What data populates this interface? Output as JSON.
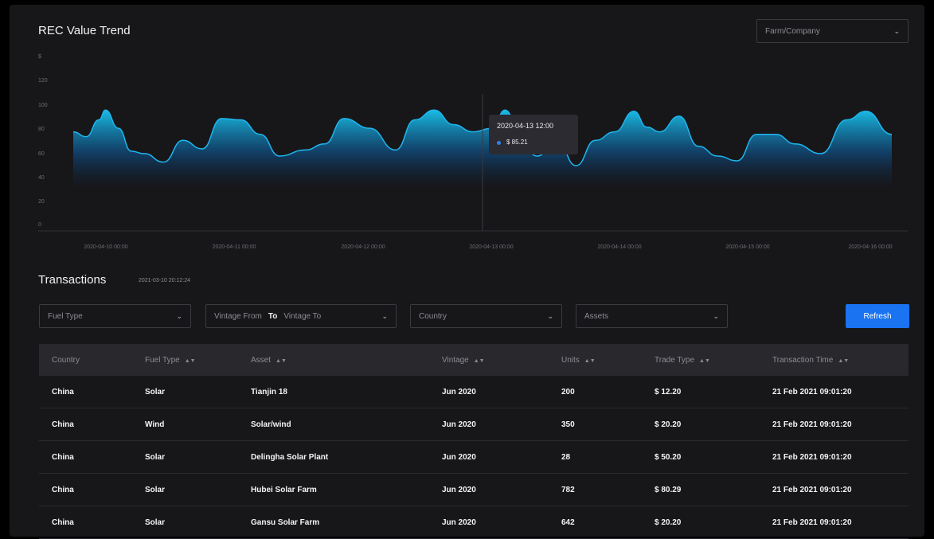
{
  "chart": {
    "title": "REC Value Trend",
    "filter_select": {
      "value": "Farm/Company"
    },
    "tooltip": {
      "time": "2020-04-13 12:00",
      "value": "$ 85.21"
    }
  },
  "chart_data": {
    "type": "area",
    "title": "REC Value Trend",
    "ylabel": "$",
    "ylim": [
      0,
      120
    ],
    "yticks": [
      "$",
      "120",
      "100",
      "80",
      "60",
      "40",
      "20",
      "0"
    ],
    "xticks": [
      "2020-04-10 00:00",
      "2020-04-11 00:00",
      "2020-04-12 00:00",
      "2020-04-13 00:00",
      "2020-04-14 00:00",
      "2020-04-15 00:00",
      "2020-04-16 00:00"
    ],
    "series": [
      {
        "x_days": [
          0,
          0.1,
          0.2,
          0.25,
          0.35,
          0.45,
          0.55,
          0.7,
          0.85,
          1.0,
          1.15,
          1.3,
          1.45,
          1.6,
          1.8,
          1.95,
          2.1,
          2.3,
          2.5,
          2.65,
          2.8,
          2.95,
          3.1,
          3.25,
          3.35,
          3.5,
          3.6,
          3.75,
          3.9,
          4.05,
          4.2,
          4.35,
          4.45,
          4.55,
          4.7,
          4.85,
          5.0,
          5.15,
          5.3,
          5.45,
          5.6,
          5.8,
          6.0,
          6.15,
          6.35
        ],
        "values": [
          82,
          78,
          92,
          100,
          85,
          66,
          64,
          57,
          75,
          68,
          93,
          92,
          80,
          62,
          67,
          72,
          93,
          85,
          67,
          92,
          100,
          88,
          82,
          85,
          100,
          68,
          62,
          76,
          54,
          75,
          82,
          99,
          86,
          82,
          95,
          70,
          62,
          58,
          80,
          80,
          72,
          64,
          92,
          99,
          80
        ]
      }
    ],
    "colors": {
      "line": "#1fb6ef",
      "fill_top": "#19c4ee",
      "fill_bottom": "#0d2a4a"
    }
  },
  "transactions": {
    "title": "Transactions",
    "timestamp": "2021-03-10 20:12:24",
    "filters": {
      "fuel_type": "Fuel Type",
      "vintage_from": "Vintage From",
      "to": "To",
      "vintage_to": "Vintage To",
      "country": "Country",
      "assets": "Assets"
    },
    "refresh_label": "Refresh",
    "columns": [
      "Country",
      "Fuel Type",
      "Asset",
      "Vintage",
      "Units",
      "Trade Type",
      "Transaction Time"
    ],
    "rows": [
      [
        "China",
        "Solar",
        "Tianjin 18",
        "Jun 2020",
        "200",
        "$ 12.20",
        "21 Feb 2021 09:01:20"
      ],
      [
        "China",
        "Wind",
        "Solar/wind",
        "Jun 2020",
        "350",
        "$ 20.20",
        "21 Feb 2021 09:01:20"
      ],
      [
        "China",
        "Solar",
        "Delingha Solar Plant",
        "Jun 2020",
        "28",
        "$ 50.20",
        "21 Feb 2021 09:01:20"
      ],
      [
        "China",
        "Solar",
        "Hubei Solar Farm",
        "Jun 2020",
        "782",
        "$ 80.29",
        "21 Feb 2021 09:01:20"
      ],
      [
        "China",
        "Solar",
        "Gansu Solar Farm",
        "Jun 2020",
        "642",
        "$ 20.20",
        "21 Feb 2021 09:01:20"
      ]
    ],
    "sort_icon": "sort-icon",
    "chevron_icon": "chevron-down-icon"
  }
}
